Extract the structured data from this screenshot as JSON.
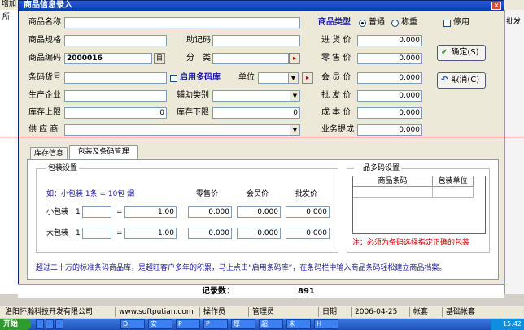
{
  "window": {
    "title": "商品信息录入",
    "close": "×"
  },
  "background": {
    "strip_left": "增加",
    "tree_item": "所",
    "right_strip": "批发"
  },
  "form": {
    "name_label": "商品名称",
    "spec_label": "商品规格",
    "mnemonic_label": "助记码",
    "code_label": "商品编码",
    "code_value": "2000016",
    "code_btn": "目",
    "category_label": "分　类",
    "barcode_label": "条码货号",
    "enable_multi_label": "启用多码库",
    "unit_label": "单位",
    "maker_label": "生产企业",
    "aux_category_label": "辅助类别",
    "stock_upper_label": "库存上限",
    "stock_upper_value": "0",
    "stock_lower_label": "库存下限",
    "stock_lower_value": "0",
    "supplier_label": "供 应 商"
  },
  "goods_type": {
    "label": "商品类型",
    "options": [
      "普通",
      "称重"
    ],
    "selected": "普通"
  },
  "disable_label": "停用",
  "prices": {
    "purchase_label": "进 货 价",
    "retail_label": "零 售 价",
    "member_label": "会 员 价",
    "wholesale_label": "批 发 价",
    "cost_label": "成 本 价",
    "commission_label": "业务提成",
    "purchase_value": "0.000",
    "retail_value": "0.000",
    "member_value": "0.000",
    "wholesale_value": "0.000",
    "cost_value": "0.000",
    "commission_value": "0.000"
  },
  "buttons": {
    "ok": "确定(S)",
    "cancel": "取消(C)"
  },
  "tabs": [
    "库存信息",
    "包装及条码管理"
  ],
  "packaging": {
    "group_title": "包装设置",
    "example": "如：小包装 1条 = 10包 烟",
    "col_retail": "零售价",
    "col_member": "会员价",
    "col_wholesale": "批发价",
    "small_label": "小包装",
    "small_num": "1",
    "small_eq": "=",
    "small_qty": "1.00",
    "small_retail": "0.000",
    "small_member": "0.000",
    "small_wholesale": "0.000",
    "large_label": "大包装",
    "large_num": "1",
    "large_eq": "=",
    "large_qty": "1.00",
    "large_retail": "0.000",
    "large_member": "0.000",
    "large_wholesale": "0.000"
  },
  "multicode": {
    "group_title": "一品多码设置",
    "col_code": "商品条码",
    "col_unit": "包装单位",
    "note": "注：必须为条码选择指定正确的包装"
  },
  "hint": "超过二十万的标准条码商品库，是超旺客户多年的积累，马上点击“启用条码库”，在条码栏中输入商品条码轻松建立商品档案。",
  "records": {
    "label": "记录数：",
    "value": "891"
  },
  "statusbar": {
    "company": "洛阳怀瀚科技开发有限公司",
    "website": "www.softputian.com",
    "operator_label": "操作员",
    "operator_value": "管理员",
    "date_label": "日期",
    "date_value": "2006-04-25",
    "account_label": "帐套",
    "account_value": "基础帐套"
  },
  "taskbar": {
    "start": "开始",
    "items": [
      "D:",
      "安",
      "P",
      "P",
      "厚",
      "超",
      "未",
      "H"
    ],
    "time": "15:42"
  },
  "colors": {
    "title_blue": "#0a3bb0",
    "label_blue": "#1a1aa0",
    "note_red": "#d00000",
    "divider_red": "#c00000"
  }
}
